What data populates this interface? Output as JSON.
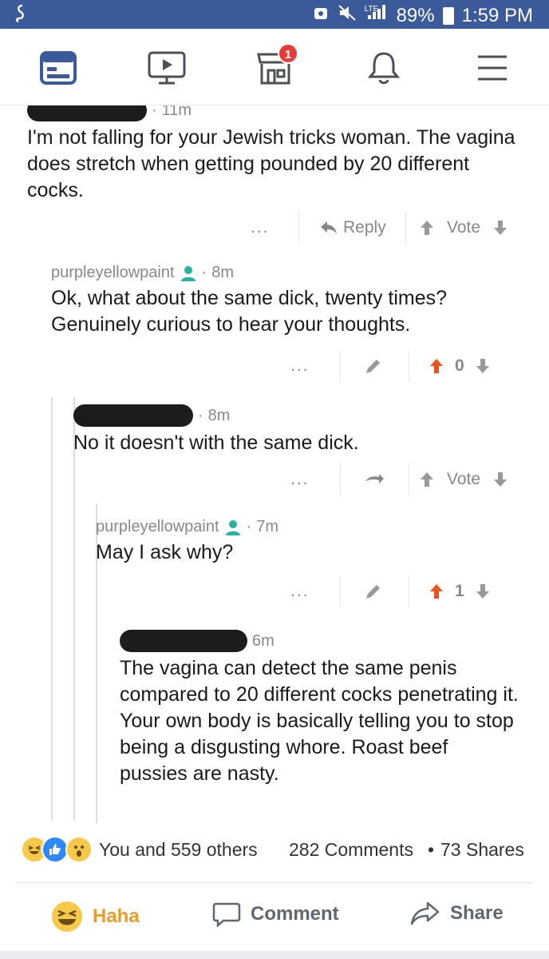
{
  "status_bar": {
    "left_icon": "app-logo-icon",
    "lte": "LTE",
    "battery": "89%",
    "time": "1:59 PM"
  },
  "nav": {
    "items": [
      "news-feed-icon",
      "watch-icon",
      "marketplace-icon",
      "notifications-icon",
      "menu-icon"
    ],
    "marketplace_badge": "1"
  },
  "thread": {
    "comment1": {
      "time": "11m",
      "body": "I'm not falling for your Jewish tricks woman. The vagina does stretch when getting pounded by 20 different cocks.",
      "more": "...",
      "reply": "Reply",
      "vote": "Vote"
    },
    "comment2": {
      "user": "purpleyellowpaint",
      "time": "8m",
      "body": "Ok, what about the same dick, twenty times? Genuinely curious to hear your thoughts.",
      "more": "...",
      "score": "0"
    },
    "comment3": {
      "time": "8m",
      "body": "No it doesn't with the same dick.",
      "more": "...",
      "vote": "Vote"
    },
    "comment4": {
      "user": "purpleyellowpaint",
      "time": "7m",
      "body": "May I ask why?",
      "more": "...",
      "score": "1"
    },
    "comment5": {
      "time": "6m",
      "body": "The vagina can detect the same penis compared to 20 different cocks penetrating it. Your own body is basically telling you to stop being a disgusting whore. Roast beef pussies are nasty."
    }
  },
  "footer": {
    "reactions_text": "You and 559 others",
    "comments": "282 Comments",
    "shares": "73 Shares",
    "separator": "•",
    "haha": "Haha",
    "comment": "Comment",
    "share": "Share"
  },
  "colors": {
    "fb_blue": "#3a5a99",
    "upvote_orange": "#e8541c",
    "teal": "#2ab3a2",
    "haha_yellow": "#f7c94a"
  }
}
